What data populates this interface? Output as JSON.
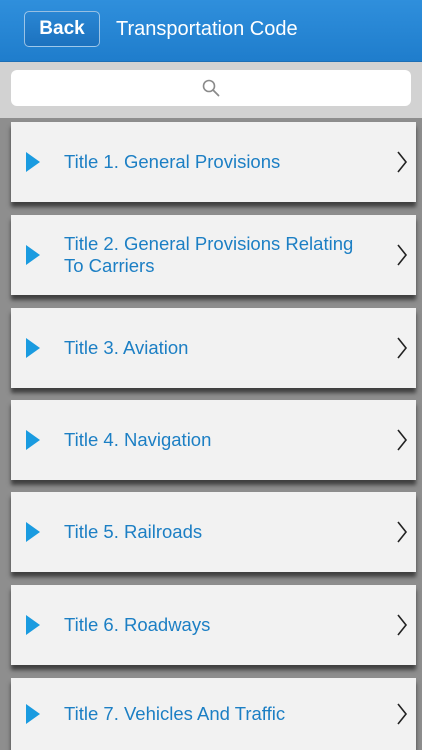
{
  "navbar": {
    "back_label": "Back",
    "title": "Transportation Code",
    "color": "#2a88d6"
  },
  "search": {
    "placeholder": "",
    "icon": "search-icon"
  },
  "list": {
    "items": [
      {
        "label": "Title 1. General Provisions"
      },
      {
        "label": "Title 2. General Provisions Relating To Carriers"
      },
      {
        "label": "Title 3. Aviation"
      },
      {
        "label": "Title 4. Navigation"
      },
      {
        "label": "Title 5. Railroads"
      },
      {
        "label": "Title 6. Roadways"
      },
      {
        "label": "Title 7. Vehicles And Traffic"
      }
    ],
    "accent_color": "#1a9be0",
    "text_color": "#1c7fc4"
  }
}
